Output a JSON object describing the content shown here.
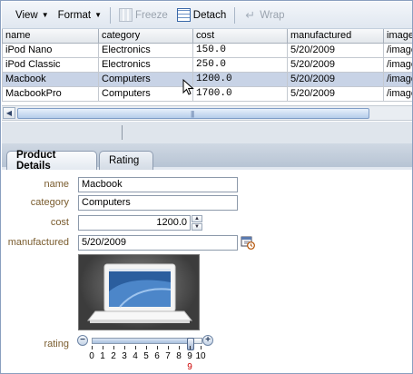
{
  "toolbar": {
    "view_label": "View",
    "format_label": "Format",
    "freeze_label": "Freeze",
    "detach_label": "Detach",
    "wrap_label": "Wrap"
  },
  "table": {
    "columns": [
      "name",
      "category",
      "cost",
      "manufactured",
      "image"
    ],
    "rows": [
      {
        "name": "iPod Nano",
        "category": "Electronics",
        "cost": "150.0",
        "manufactured": "5/20/2009",
        "image": "/image"
      },
      {
        "name": "iPod Classic",
        "category": "Electronics",
        "cost": "250.0",
        "manufactured": "5/20/2009",
        "image": "/image"
      },
      {
        "name": "Macbook",
        "category": "Computers",
        "cost": "1200.0",
        "manufactured": "5/20/2009",
        "image": "/image"
      },
      {
        "name": "MacbookPro",
        "category": "Computers",
        "cost": "1700.0",
        "manufactured": "5/20/2009",
        "image": "/image"
      }
    ],
    "selected_row": 2
  },
  "scrollbar": {
    "grip": "|||"
  },
  "tabs": [
    {
      "label": "Product Details",
      "active": true
    },
    {
      "label": "Rating",
      "active": false
    }
  ],
  "form": {
    "name_label": "name",
    "name_value": "Macbook",
    "category_label": "category",
    "category_value": "Computers",
    "cost_label": "cost",
    "cost_value": "1200.0",
    "manufactured_label": "manufactured",
    "manufactured_value": "5/20/2009",
    "rating_label": "rating"
  },
  "rating": {
    "min": 0,
    "max": 10,
    "value": 9,
    "ticks": [
      "0",
      "1",
      "2",
      "3",
      "4",
      "5",
      "6",
      "7",
      "8",
      "9",
      "10"
    ],
    "value_label": "9"
  },
  "colors": {
    "label_brown": "#7a5c2e",
    "selected_row": "#c8d3e6",
    "rating_value": "#cc0000"
  }
}
